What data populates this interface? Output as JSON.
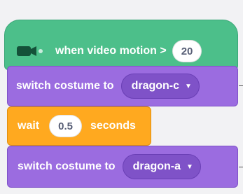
{
  "blocks": {
    "hat": {
      "icon": "video-camera-icon",
      "label": "when video motion >",
      "value": "20",
      "color": "#4cbf8a"
    },
    "switch1": {
      "label": "switch costume to",
      "costume": "dragon-c",
      "color": "#9b6ce0"
    },
    "wait": {
      "label_before": "wait",
      "value": "0.5",
      "label_after": "seconds",
      "color": "#ffa91f"
    },
    "switch2": {
      "label": "switch costume to",
      "costume": "dragon-a",
      "color": "#9b6ce0"
    }
  }
}
